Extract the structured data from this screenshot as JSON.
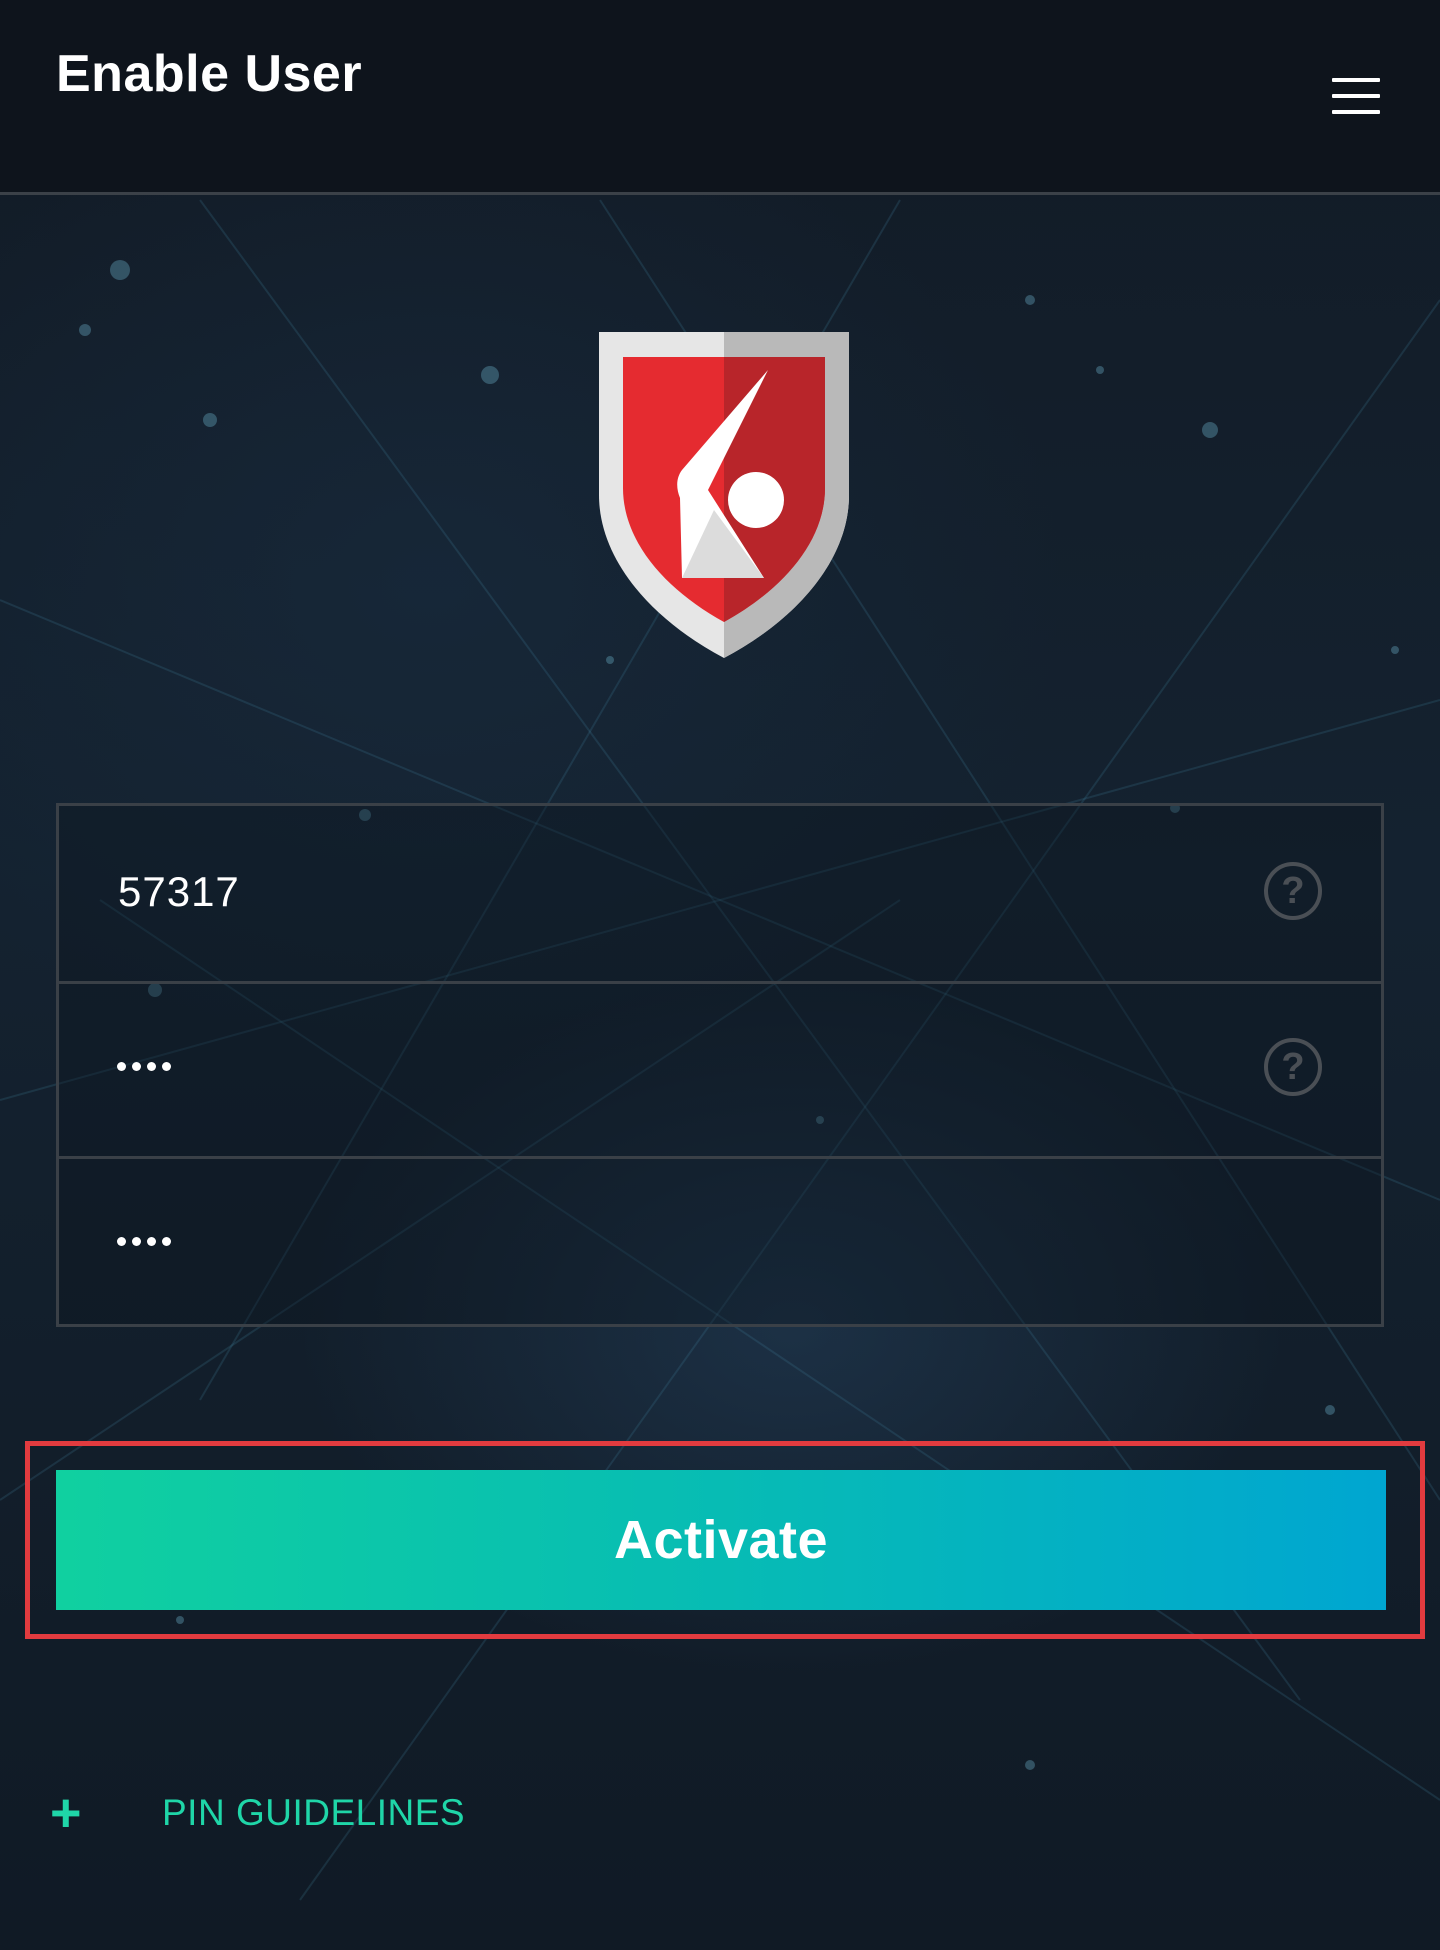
{
  "header": {
    "title": "Enable User",
    "menu_icon": "hamburger-menu-icon"
  },
  "logo": {
    "icon": "shield-logo-icon",
    "colors": [
      "#e52b30",
      "#b8252a",
      "#e6e6e6",
      "#b9b9b9"
    ]
  },
  "form": {
    "fields": [
      {
        "value": "57317",
        "help_icon": "question-mark-icon"
      },
      {
        "value": "••••",
        "masked": true,
        "help_icon": "question-mark-icon"
      },
      {
        "value": "••••",
        "masked": true
      }
    ]
  },
  "activate_button": {
    "label": "Activate",
    "gradient": [
      "#10d0a0",
      "#00a6d1"
    ],
    "highlight_color": "#e23b3f"
  },
  "pin_guidelines": {
    "icon": "plus-icon",
    "label": "PIN GUIDELINES",
    "color": "#1fd6a8"
  }
}
